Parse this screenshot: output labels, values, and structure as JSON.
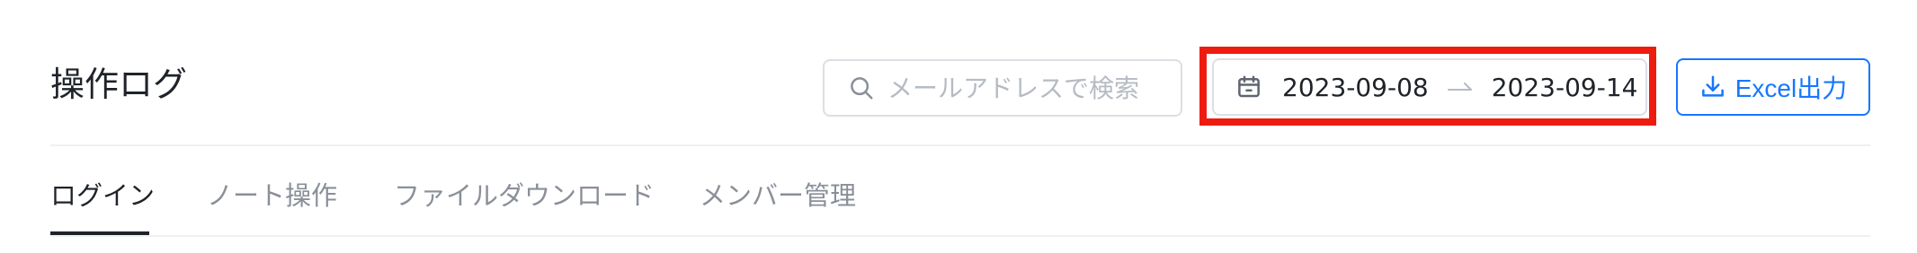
{
  "page": {
    "title": "操作ログ"
  },
  "search": {
    "placeholder": "メールアドレスで検索",
    "value": ""
  },
  "date_range": {
    "start": "2023-09-08",
    "end": "2023-09-14"
  },
  "toolbar": {
    "export_label": "Excel出力"
  },
  "tabs": [
    {
      "label": "ログイン",
      "active": true
    },
    {
      "label": "ノート操作",
      "active": false
    },
    {
      "label": "ファイルダウンロード",
      "active": false
    },
    {
      "label": "メンバー管理",
      "active": false
    }
  ],
  "colors": {
    "accent": "#1677ff",
    "highlight": "#ee1c0f",
    "text": "#1f2329",
    "muted": "#8a8f98",
    "border": "#dcdfe4"
  },
  "icons": {
    "search": "search-icon",
    "calendar": "calendar-icon",
    "range_arrow": "arrow-right-icon",
    "export": "download-icon"
  }
}
